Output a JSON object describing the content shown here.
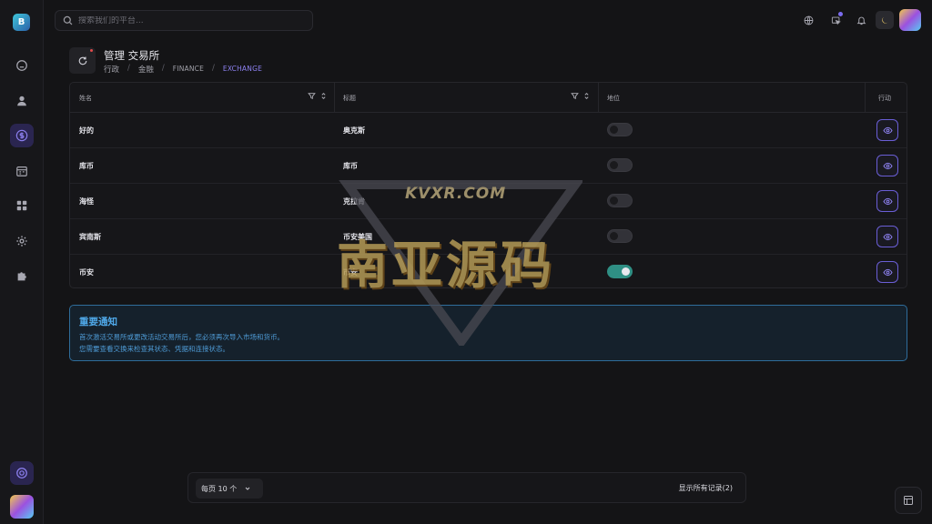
{
  "search": {
    "placeholder": "搜索我们的平台..."
  },
  "sidebar": {
    "logo_text": "B",
    "items": [
      {
        "name": "home",
        "icon": "home-icon",
        "active": false
      },
      {
        "name": "users",
        "icon": "user-icon",
        "active": false
      },
      {
        "name": "finance",
        "icon": "dollar-icon",
        "active": true
      },
      {
        "name": "calendar",
        "icon": "calendar-icon",
        "active": false
      },
      {
        "name": "apps",
        "icon": "grid-icon",
        "active": false
      },
      {
        "name": "settings",
        "icon": "gear-icon",
        "active": false
      },
      {
        "name": "extensions",
        "icon": "puzzle-icon",
        "active": false
      }
    ]
  },
  "page": {
    "title": "管理 交易所",
    "breadcrumb": [
      "行政",
      "金融",
      "FINANCE",
      "EXCHANGE"
    ]
  },
  "table": {
    "columns": [
      "姓名",
      "标题",
      "地位",
      "行动"
    ],
    "rows": [
      {
        "name": "好的",
        "title": "奥克斯",
        "status": false
      },
      {
        "name": "库币",
        "title": "库币",
        "status": false
      },
      {
        "name": "海怪",
        "title": "克拉肯",
        "status": false
      },
      {
        "name": "宾南斯",
        "title": "币安美国",
        "status": false
      },
      {
        "name": "币安",
        "title": "币安",
        "status": true
      }
    ]
  },
  "notice": {
    "title": "重要通知",
    "lines": [
      "首次激活交易所或更改活动交易所后，您必须再次导入市场和货币。",
      "您需要查看交换来检查其状态、凭据和连接状态。"
    ]
  },
  "watermark": {
    "site": "KVXR.COM",
    "text": "南亚源码"
  },
  "pager": {
    "per_page": "每页 10 个",
    "records": "显示所有记录(2)"
  },
  "colors": {
    "accent": "#7c6cf0",
    "toggle_on": "#2f8f84",
    "notice": "#4fa8e8"
  }
}
